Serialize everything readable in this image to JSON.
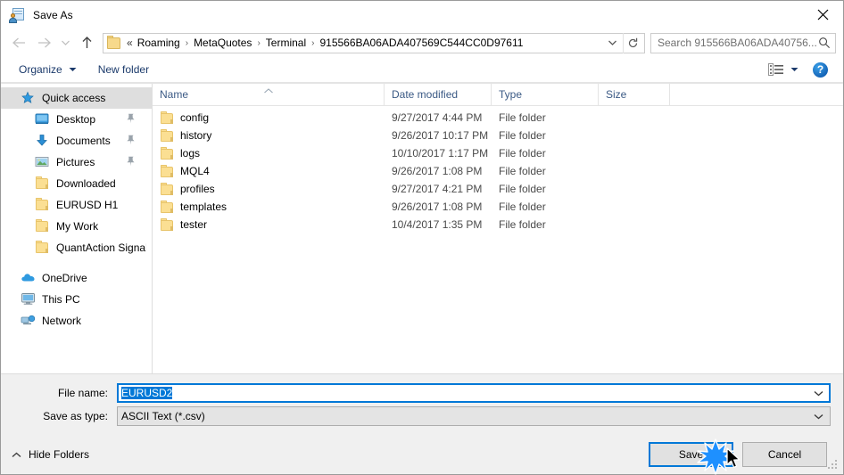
{
  "window": {
    "title": "Save As",
    "icon": "save-as-icon",
    "close_label": "✕"
  },
  "nav": {
    "back": "back-arrow",
    "forward": "forward-arrow",
    "recent": "recent-locations-chevron",
    "up": "up-arrow",
    "breadcrumb_prefix": "«",
    "breadcrumbs": [
      "Roaming",
      "MetaQuotes",
      "Terminal",
      "915566BA06ADA407569C544CC0D97611"
    ],
    "separator": "›",
    "dropdown": "chevron-down-icon",
    "refresh": "refresh-icon"
  },
  "search": {
    "placeholder": "Search 915566BA06ADA40756...",
    "icon": "search-icon"
  },
  "toolbar": {
    "organize_label": "Organize",
    "new_folder_label": "New folder",
    "view_icon": "view-options-icon",
    "help_label": "?"
  },
  "sidebar": {
    "groups": [
      {
        "header": {
          "label": "Quick access",
          "icon": "star-icon",
          "selected": true
        },
        "items": [
          {
            "label": "Desktop",
            "icon": "desktop-icon",
            "pinned": true
          },
          {
            "label": "Documents",
            "icon": "documents-icon",
            "pinned": true
          },
          {
            "label": "Pictures",
            "icon": "pictures-icon",
            "pinned": true
          },
          {
            "label": "Downloaded",
            "icon": "folder-icon",
            "pinned": false
          },
          {
            "label": "EURUSD H1",
            "icon": "folder-icon",
            "pinned": false
          },
          {
            "label": "My Work",
            "icon": "folder-icon",
            "pinned": false
          },
          {
            "label": "QuantAction Signal",
            "icon": "folder-icon",
            "pinned": false
          }
        ]
      },
      {
        "header": {
          "label": "OneDrive",
          "icon": "onedrive-icon",
          "selected": false
        },
        "items": []
      },
      {
        "header": {
          "label": "This PC",
          "icon": "this-pc-icon",
          "selected": false
        },
        "items": []
      },
      {
        "header": {
          "label": "Network",
          "icon": "network-icon",
          "selected": false
        },
        "items": []
      }
    ]
  },
  "filelist": {
    "columns": [
      "Name",
      "Date modified",
      "Type",
      "Size"
    ],
    "sort_column": "Name",
    "sort_direction": "ascending",
    "rows": [
      {
        "name": "config",
        "date": "9/27/2017 4:44 PM",
        "type": "File folder",
        "size": ""
      },
      {
        "name": "history",
        "date": "9/26/2017 10:17 PM",
        "type": "File folder",
        "size": ""
      },
      {
        "name": "logs",
        "date": "10/10/2017 1:17 PM",
        "type": "File folder",
        "size": ""
      },
      {
        "name": "MQL4",
        "date": "9/26/2017 1:08 PM",
        "type": "File folder",
        "size": ""
      },
      {
        "name": "profiles",
        "date": "9/27/2017 4:21 PM",
        "type": "File folder",
        "size": ""
      },
      {
        "name": "templates",
        "date": "9/26/2017 1:08 PM",
        "type": "File folder",
        "size": ""
      },
      {
        "name": "tester",
        "date": "10/4/2017 1:35 PM",
        "type": "File folder",
        "size": ""
      }
    ]
  },
  "form": {
    "filename_label": "File name:",
    "filename_value": "EURUSD2",
    "filetype_label": "Save as type:",
    "filetype_value": "ASCII Text (*.csv)"
  },
  "footer": {
    "hide_folders_label": "Hide Folders",
    "save_label": "Save",
    "cancel_label": "Cancel"
  },
  "colors": {
    "accent": "#0078d7",
    "folder": "#fbdf93",
    "selection": "#dedede",
    "help_blue": "#1565b8"
  }
}
